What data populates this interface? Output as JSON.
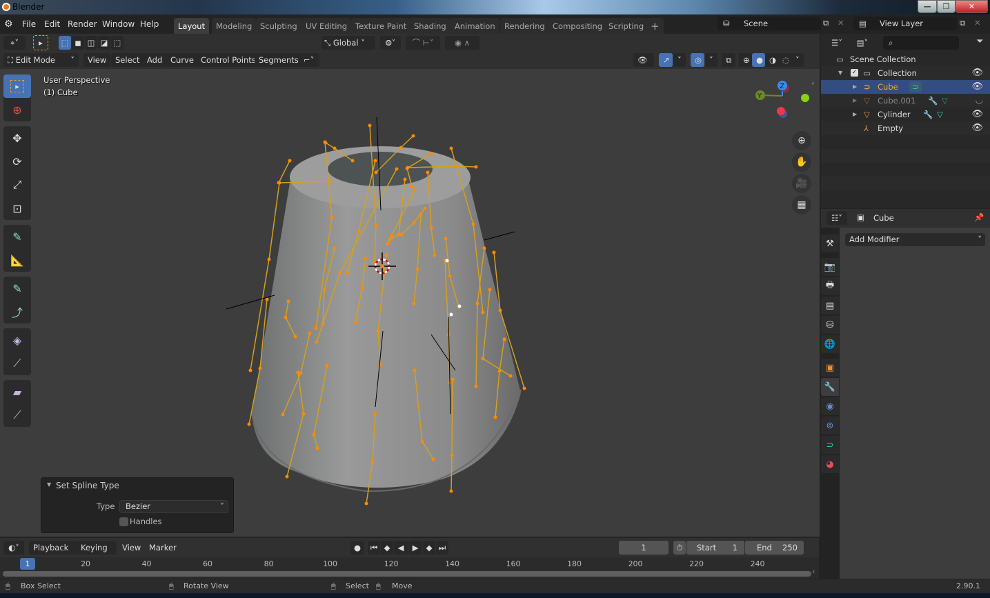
{
  "window": {
    "title": "Blender",
    "controls": [
      "minimize",
      "restore",
      "close"
    ]
  },
  "menu": [
    "File",
    "Edit",
    "Render",
    "Window",
    "Help"
  ],
  "workspaces": [
    {
      "label": "Layout",
      "active": true
    },
    {
      "label": "Modeling"
    },
    {
      "label": "Sculpting"
    },
    {
      "label": "UV Editing"
    },
    {
      "label": "Texture Paint"
    },
    {
      "label": "Shading"
    },
    {
      "label": "Animation"
    },
    {
      "label": "Rendering"
    },
    {
      "label": "Compositing"
    },
    {
      "label": "Scripting"
    },
    {
      "label": "+"
    }
  ],
  "scene": {
    "name": "Scene",
    "view_layer": "View Layer"
  },
  "header": {
    "transform_orientation": "Global",
    "mode": "Edit Mode",
    "menus": [
      "View",
      "Select",
      "Add",
      "Curve",
      "Control Points",
      "Segments"
    ]
  },
  "viewport": {
    "perspective_label": "User Perspective",
    "object_label": "(1) Cube",
    "gizmo_axes": [
      "Z",
      "Y"
    ],
    "shading_active": "solid"
  },
  "operator_panel": {
    "title": "Set Spline Type",
    "type_label": "Type",
    "type_value": "Bezier",
    "handles_label": "Handles",
    "handles_checked": false
  },
  "outliner": {
    "root": "Scene Collection",
    "collection": "Collection",
    "items": [
      {
        "name": "Cube",
        "type": "curve",
        "selected": true,
        "visible": true
      },
      {
        "name": "Cube.001",
        "type": "mesh",
        "selected": false,
        "visible": false
      },
      {
        "name": "Cylinder",
        "type": "mesh",
        "selected": false,
        "visible": true
      },
      {
        "name": "Empty",
        "type": "empty",
        "selected": false,
        "visible": true
      }
    ]
  },
  "properties": {
    "object_name": "Cube",
    "add_modifier_label": "Add Modifier",
    "active_tab": "modifiers"
  },
  "timeline": {
    "menus": [
      "Playback",
      "Keying",
      "View",
      "Marker"
    ],
    "current_frame": "1",
    "start_label": "Start",
    "start": "1",
    "end_label": "End",
    "end": "250",
    "ticks": [
      "20",
      "40",
      "60",
      "80",
      "100",
      "120",
      "140",
      "160",
      "180",
      "200",
      "220",
      "240"
    ],
    "playhead": "1"
  },
  "status": {
    "left": "Box Select",
    "middle": "Rotate View",
    "select": "Select",
    "move": "Move",
    "version": "2.90.1"
  }
}
